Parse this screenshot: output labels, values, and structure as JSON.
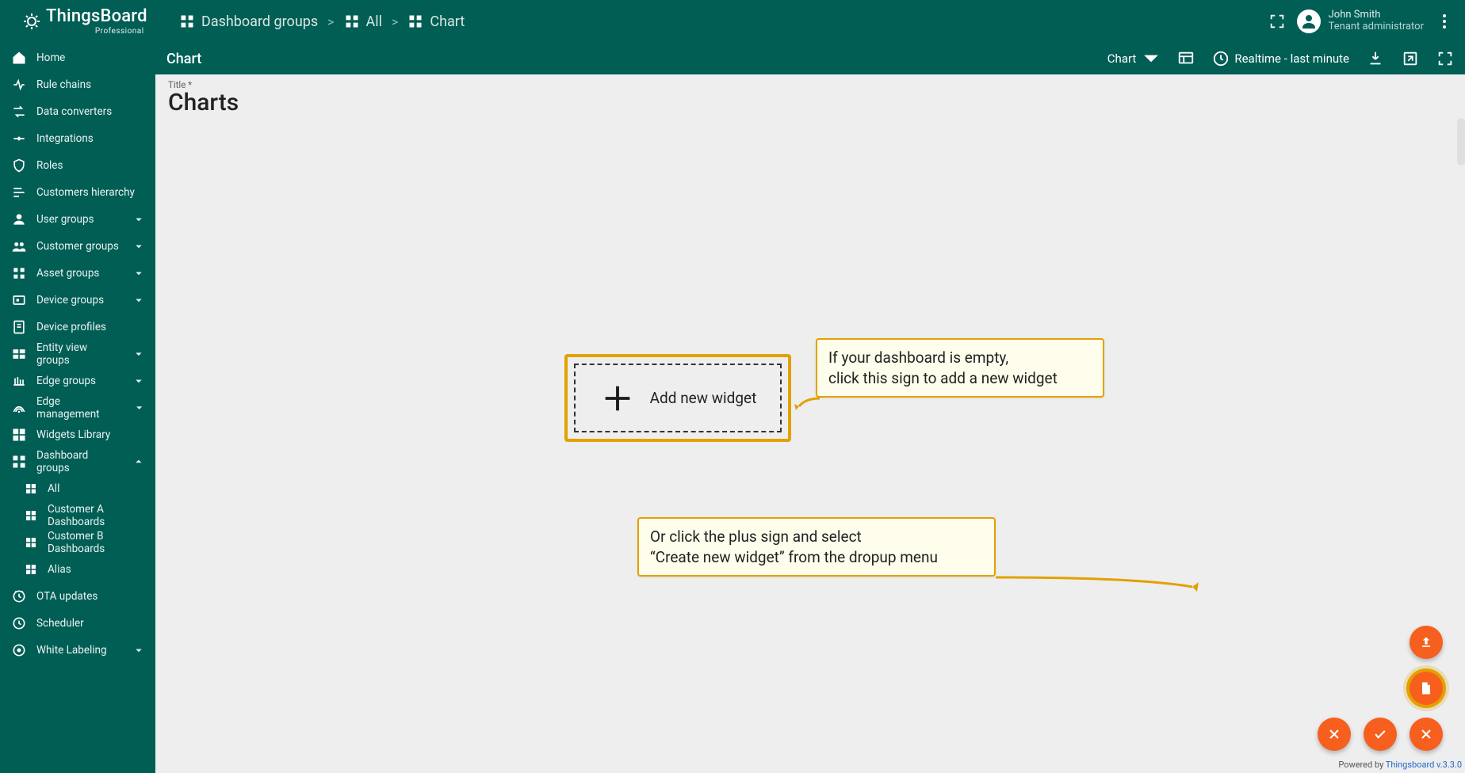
{
  "app": {
    "name": "ThingsBoard",
    "edition": "Professional"
  },
  "breadcrumb": [
    {
      "label": "Dashboard groups"
    },
    {
      "label": "All"
    },
    {
      "label": "Chart"
    }
  ],
  "user": {
    "name": "John Smith",
    "role": "Tenant administrator"
  },
  "sidebar": [
    {
      "icon": "home",
      "label": "Home"
    },
    {
      "icon": "rule",
      "label": "Rule chains"
    },
    {
      "icon": "convert",
      "label": "Data converters"
    },
    {
      "icon": "integration",
      "label": "Integrations"
    },
    {
      "icon": "shield",
      "label": "Roles"
    },
    {
      "icon": "hierarchy",
      "label": "Customers hierarchy"
    },
    {
      "icon": "user",
      "label": "User groups",
      "expand": "down"
    },
    {
      "icon": "customers",
      "label": "Customer groups",
      "expand": "down"
    },
    {
      "icon": "asset",
      "label": "Asset groups",
      "expand": "down"
    },
    {
      "icon": "device",
      "label": "Device groups",
      "expand": "down"
    },
    {
      "icon": "profile",
      "label": "Device profiles"
    },
    {
      "icon": "entity",
      "label": "Entity view groups",
      "expand": "down"
    },
    {
      "icon": "edge",
      "label": "Edge groups",
      "expand": "down"
    },
    {
      "icon": "edgemgmt",
      "label": "Edge management",
      "expand": "down"
    },
    {
      "icon": "widgets",
      "label": "Widgets Library"
    },
    {
      "icon": "dashgroups",
      "label": "Dashboard groups",
      "expand": "up"
    },
    {
      "icon": "dash",
      "label": "All",
      "sub": true
    },
    {
      "icon": "dash",
      "label": "Customer A Dashboards",
      "sub": true
    },
    {
      "icon": "dash",
      "label": "Customer B Dashboards",
      "sub": true
    },
    {
      "icon": "dash",
      "label": "Alias",
      "sub": true
    },
    {
      "icon": "ota",
      "label": "OTA updates"
    },
    {
      "icon": "clock",
      "label": "Scheduler"
    },
    {
      "icon": "label",
      "label": "White Labeling",
      "expand": "down"
    }
  ],
  "dashboard": {
    "title": "Chart",
    "state_select": "Chart",
    "time_label": "Realtime - last minute",
    "field_label": "Title *",
    "page_title": "Charts"
  },
  "placeholder": {
    "add_widget": "Add new widget"
  },
  "callouts": {
    "c1_l1": "If your dashboard is empty,",
    "c1_l2": "click this sign to add a new widget",
    "c2_l1": "Or click the plus sign and select",
    "c2_l2": "“Create new widget” from the dropup menu"
  },
  "footer": {
    "powered_prefix": "Powered by ",
    "powered_link": "Thingsboard v.3.3.0"
  }
}
